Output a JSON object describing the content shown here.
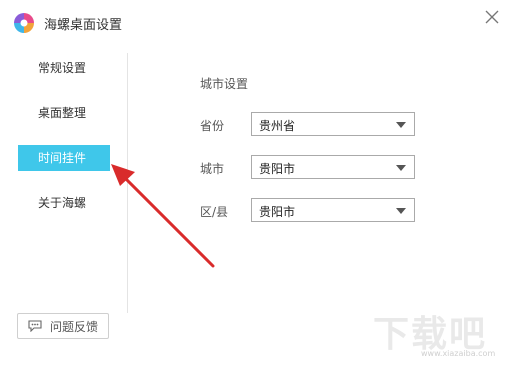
{
  "window": {
    "title": "海螺桌面设置"
  },
  "sidebar": {
    "items": [
      {
        "label": "常规设置",
        "active": false
      },
      {
        "label": "桌面整理",
        "active": false
      },
      {
        "label": "时间挂件",
        "active": true
      },
      {
        "label": "关于海螺",
        "active": false
      }
    ],
    "feedback_label": "问题反馈"
  },
  "main": {
    "section_title": "城市设置",
    "fields": [
      {
        "label": "省份",
        "value": "贵州省"
      },
      {
        "label": "城市",
        "value": "贵阳市"
      },
      {
        "label": "区/县",
        "value": "贵阳市"
      }
    ]
  },
  "watermark": {
    "text": "下载吧",
    "url": "www.xiazaiba.com"
  },
  "colors": {
    "accent": "#3fc7ea",
    "annotation_arrow": "#d92b2b"
  },
  "icons": {
    "logo": "app-logo-icon",
    "close": "close-icon",
    "feedback": "chat-bubble-icon",
    "dropdown": "caret-down-icon"
  }
}
